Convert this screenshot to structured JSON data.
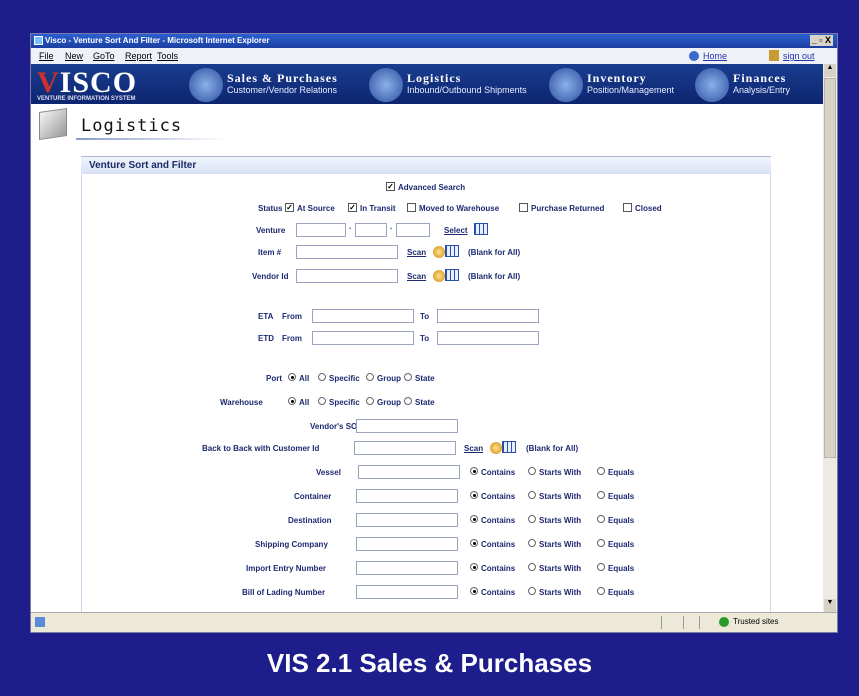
{
  "window": {
    "title": "Visco - Venture Sort And Filter - Microsoft Internet Explorer",
    "controls": "_ ▫ X"
  },
  "menu": {
    "file": "File",
    "new": "New",
    "goto": "GoTo",
    "report": "Report",
    "tools": "Tools",
    "home": "Home",
    "signout": "sign out"
  },
  "logo": {
    "main": "ISCO",
    "v": "V",
    "sub": "VENTURE INFORMATION SYSTEM"
  },
  "nav": [
    {
      "title": "Sales & Purchases",
      "sub": "Customer/Vendor Relations"
    },
    {
      "title": "Logistics",
      "sub": "Inbound/Outbound Shipments"
    },
    {
      "title": "Inventory",
      "sub": "Position/Management"
    },
    {
      "title": "Finances",
      "sub": "Analysis/Entry"
    }
  ],
  "page": {
    "title": "Logistics",
    "section": "Venture Sort and Filter"
  },
  "form": {
    "advanced_search": "Advanced Search",
    "status_label": "Status",
    "status_options": [
      "At Source",
      "In Transit",
      "Moved to Warehouse",
      "Purchase Returned",
      "Closed"
    ],
    "venture_label": "Venture",
    "select_link": "Select",
    "item_label": "Item #",
    "vendor_label": "Vendor Id",
    "scan": "Scan",
    "blank_for_all": "(Blank for All)",
    "eta_label": "ETA",
    "etd_label": "ETD",
    "from": "From",
    "to": "To",
    "port_label": "Port",
    "warehouse_label": "Warehouse",
    "loc_options": [
      "All",
      "Specific",
      "Group",
      "State"
    ],
    "vendor_so_label": "Vendor's SO",
    "b2b_label": "Back to Back with Customer Id",
    "match_fields": [
      "Vessel",
      "Container",
      "Destination",
      "Shipping Company",
      "Import Entry Number",
      "Bill of Lading Number"
    ],
    "match_options": [
      "Contains",
      "Starts With",
      "Equals"
    ]
  },
  "status": {
    "trusted": "Trusted sites"
  },
  "slide": {
    "title": "VIS 2.1 Sales & Purchases"
  }
}
